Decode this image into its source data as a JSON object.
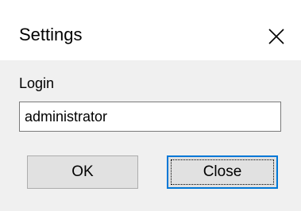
{
  "window": {
    "title": "Settings"
  },
  "titlebar": {
    "close_icon": "close-icon"
  },
  "form": {
    "login_label": "Login",
    "login_value": "administrator"
  },
  "buttons": {
    "ok_label": "OK",
    "close_label": "Close"
  },
  "colors": {
    "client_background": "#f0f0f0",
    "button_face": "#e1e1e1",
    "focus_border": "#0078d7"
  }
}
